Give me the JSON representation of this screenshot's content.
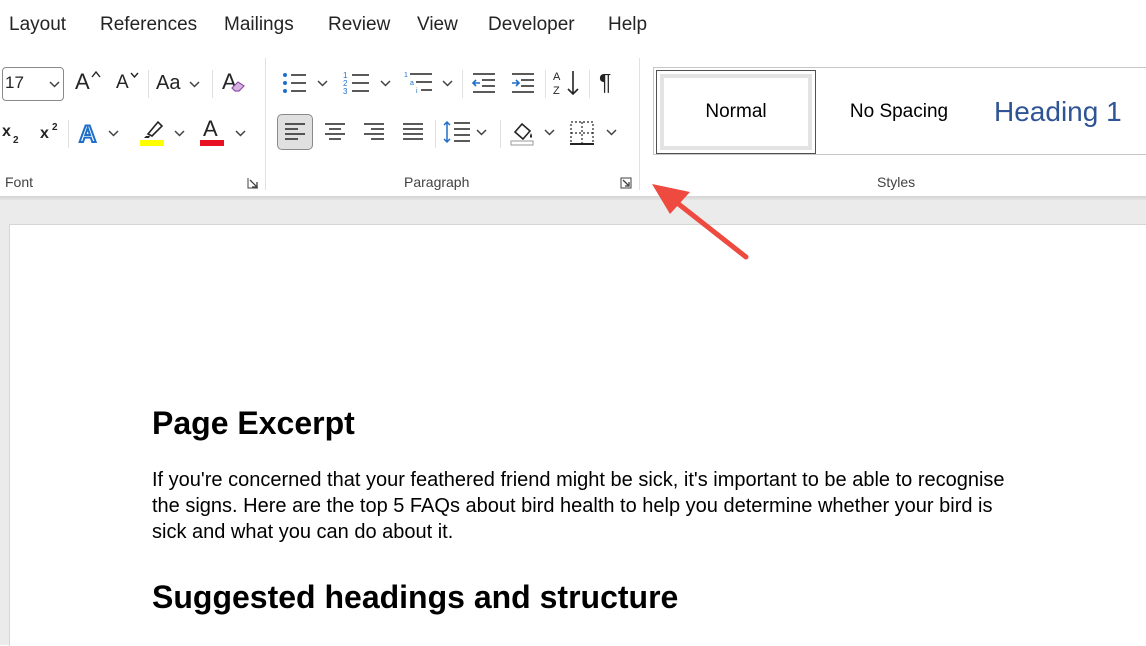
{
  "menu": {
    "items": [
      "Layout",
      "References",
      "Mailings",
      "Review",
      "View",
      "Developer",
      "Help"
    ]
  },
  "ribbon": {
    "font_group": {
      "label": "Font",
      "font_size": "17",
      "grow_font_glyph": "A",
      "shrink_font_glyph": "A",
      "change_case_glyph": "Aa",
      "clear_format_glyph": "A",
      "text_effects_glyph": "A",
      "font_color_glyph": "A",
      "highlight_color": "#ffff00",
      "font_color": "#e81123"
    },
    "paragraph_group": {
      "label": "Paragraph",
      "pilcrow": "¶"
    },
    "styles_group": {
      "label": "Styles",
      "styles": [
        "Normal",
        "No Spacing",
        "Heading 1"
      ],
      "heading_color": "#2f5496"
    }
  },
  "document": {
    "heading1": "Page Excerpt",
    "paragraph": "If you're concerned that your feathered friend might be sick, it's important to be able to recognise the signs. Here are the top 5 FAQs about bird health to help you determine whether your bird is sick and what you can do about it.",
    "heading2": "Suggested headings and structure"
  },
  "annotation": {
    "arrow_color": "#ee4a3f"
  }
}
